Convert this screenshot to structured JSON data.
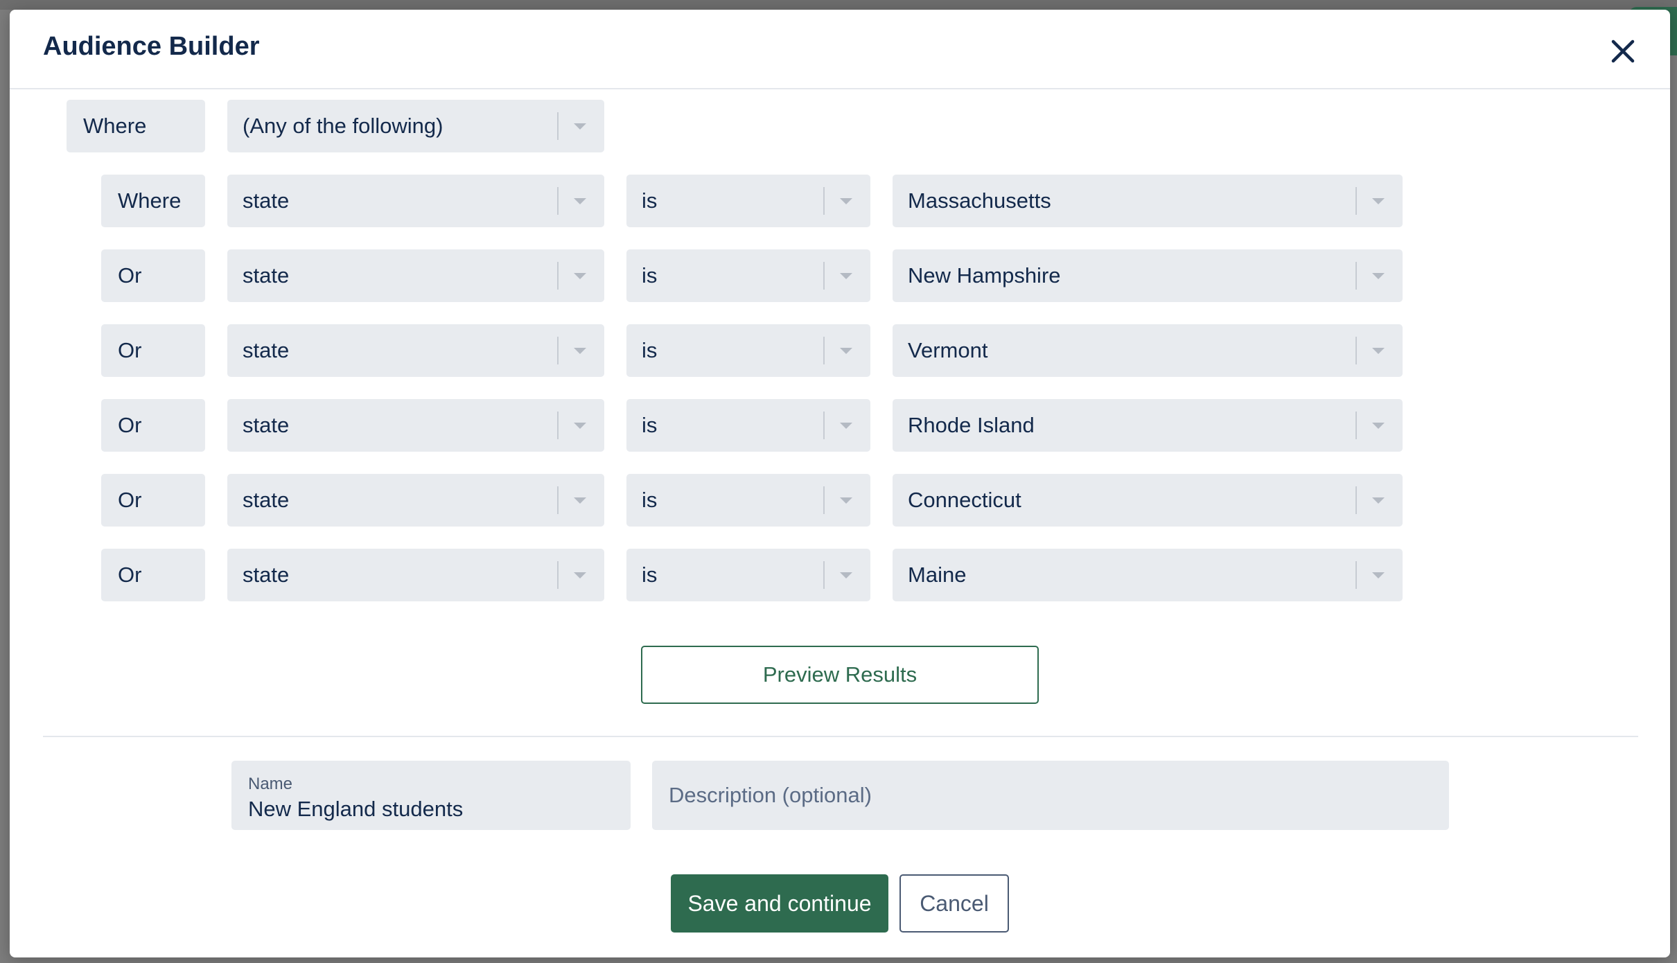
{
  "modal": {
    "title": "Audience Builder",
    "close_icon": "close-icon"
  },
  "top_group": {
    "connector": "Where",
    "match_mode": "(Any of the following)"
  },
  "conditions": [
    {
      "connector": "Where",
      "field": "state",
      "operator": "is",
      "value": "Massachusetts"
    },
    {
      "connector": "Or",
      "field": "state",
      "operator": "is",
      "value": "New Hampshire"
    },
    {
      "connector": "Or",
      "field": "state",
      "operator": "is",
      "value": "Vermont"
    },
    {
      "connector": "Or",
      "field": "state",
      "operator": "is",
      "value": "Rhode Island"
    },
    {
      "connector": "Or",
      "field": "state",
      "operator": "is",
      "value": "Connecticut"
    },
    {
      "connector": "Or",
      "field": "state",
      "operator": "is",
      "value": "Maine"
    }
  ],
  "preview_label": "Preview Results",
  "name_field": {
    "label": "Name",
    "value": "New England students"
  },
  "description_field": {
    "placeholder": "Description (optional)"
  },
  "actions": {
    "save_label": "Save and continue",
    "cancel_label": "Cancel"
  },
  "colors": {
    "accent": "#2e6b4f",
    "field_bg": "#e8ebef",
    "text": "#13294b"
  }
}
